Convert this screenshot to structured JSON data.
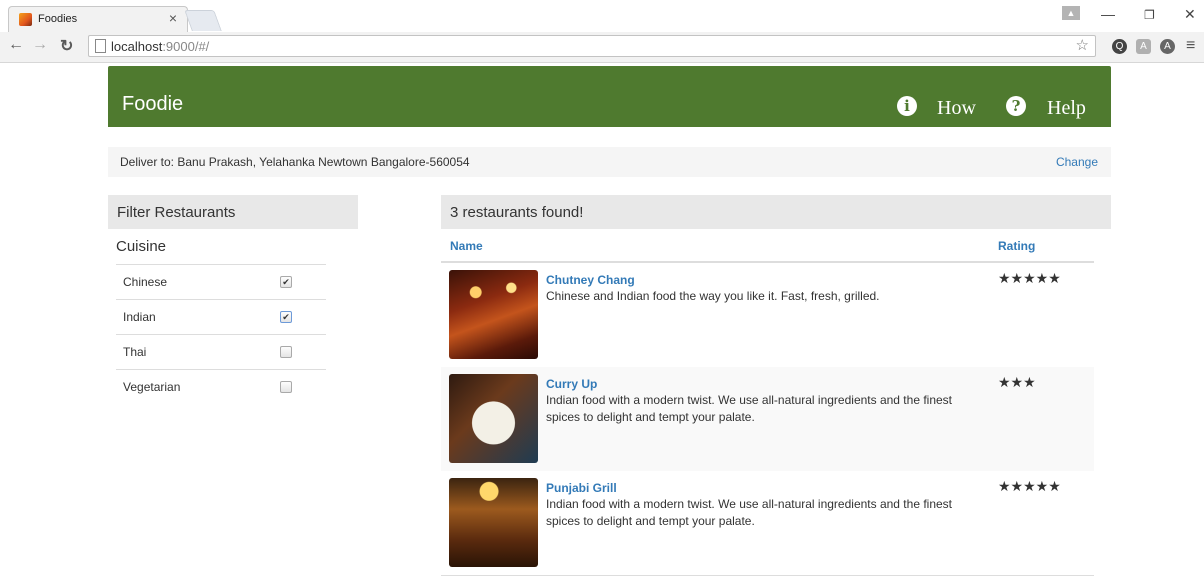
{
  "browser": {
    "tab_title": "Foodies",
    "tab_close": "×",
    "url_host": "localhost",
    "url_rest": ":9000/#/"
  },
  "app": {
    "brand": "Foodie",
    "nav": [
      {
        "label": "How",
        "icon": "info-icon",
        "glyph": "i"
      },
      {
        "label": "Help",
        "icon": "question-icon",
        "glyph": "?"
      }
    ],
    "deliver_text": "Deliver to: Banu Prakash, Yelahanka Newtown Bangalore-560054",
    "change_label": "Change",
    "filter": {
      "title": "Filter Restaurants",
      "cuisine_label": "Cuisine",
      "items": [
        {
          "label": "Chinese",
          "checked": true
        },
        {
          "label": "Indian",
          "checked": true
        },
        {
          "label": "Thai",
          "checked": false
        },
        {
          "label": "Vegetarian",
          "checked": false
        }
      ]
    },
    "results": {
      "title": "3 restaurants found!",
      "col_name": "Name",
      "col_rating": "Rating",
      "rows": [
        {
          "name": "Chutney Chang",
          "description": "Chinese and Indian food the way you like it. Fast, fresh, grilled.",
          "rating": 5,
          "stars": "★★★★★"
        },
        {
          "name": "Curry Up",
          "description": "Indian food with a modern twist. We use all-natural ingredients and the finest spices to delight and tempt your palate.",
          "rating": 3,
          "stars": "★★★"
        },
        {
          "name": "Punjabi Grill",
          "description": "Indian food with a modern twist. We use all-natural ingredients and the finest spices to delight and tempt your palate.",
          "rating": 5,
          "stars": "★★★★★"
        }
      ]
    }
  },
  "colors": {
    "navbar": "#4f7a2f",
    "link": "#337ab7"
  }
}
